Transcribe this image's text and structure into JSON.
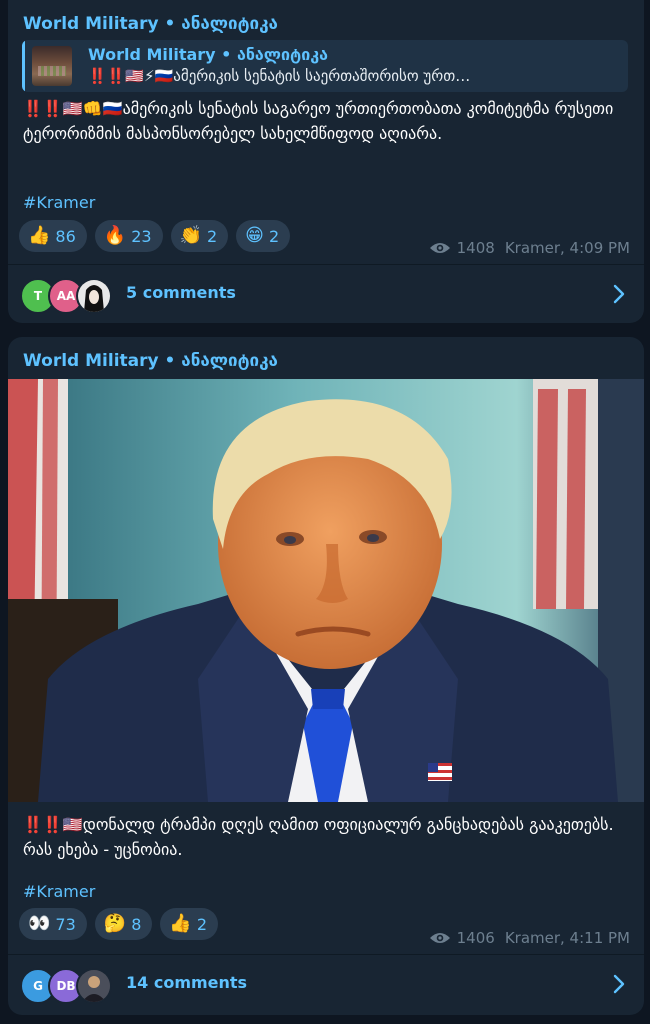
{
  "posts": [
    {
      "channel": "World Military • ანალიტიკა",
      "reply": {
        "title": "World Military • ანალიტიკა",
        "text": "‼️‼️🇺🇸⚡🇷🇺ამერიკის სენატის საერთაშორისო ურთ…"
      },
      "text": "‼️‼️🇺🇸👊🇷🇺ამერიკის სენატის საგარეო ურთიერთობათა კომიტეტმა რუსეთი ტერორიზმის მასპონსორებელ სახელმწიფოდ აღიარა.",
      "hashtag": "#Kramer",
      "reactions": [
        {
          "emoji": "👍",
          "count": "86"
        },
        {
          "emoji": "🔥",
          "count": "23"
        },
        {
          "emoji": "👏",
          "count": "2"
        },
        {
          "emoji": "😁",
          "count": "2"
        }
      ],
      "views": "1408",
      "signature": "Kramer, 4:09 PM",
      "avatars": [
        {
          "label": "T",
          "color": "#4fbf4f"
        },
        {
          "label": "AA",
          "color": "#e0608a"
        },
        {
          "label": "",
          "color": "#2a2a2a"
        }
      ],
      "comments": "5 comments"
    },
    {
      "channel": "World Military • ანალიტიკა",
      "text": "‼️‼️🇺🇸დონალდ ტრამპი დღეს ღამით ოფიციალურ განცხადებას გააკეთებს. რას ეხება - უცნობია.",
      "hashtag": "#Kramer",
      "reactions": [
        {
          "emoji": "👀",
          "count": "73"
        },
        {
          "emoji": "🤔",
          "count": "8"
        },
        {
          "emoji": "👍",
          "count": "2"
        }
      ],
      "views": "1406",
      "signature": "Kramer, 4:11 PM",
      "avatars": [
        {
          "label": "G",
          "color": "#3b9be0"
        },
        {
          "label": "DB",
          "color": "#8a6ad8"
        },
        {
          "label": "",
          "color": "#3a3a44"
        }
      ],
      "comments": "14 comments"
    }
  ],
  "colors": {
    "background": "#0e1621",
    "bubble": "#182533",
    "accent": "#5ec2ff",
    "muted": "#6d7f8f"
  },
  "icons": [
    "eye-icon",
    "chevron-right-icon"
  ]
}
